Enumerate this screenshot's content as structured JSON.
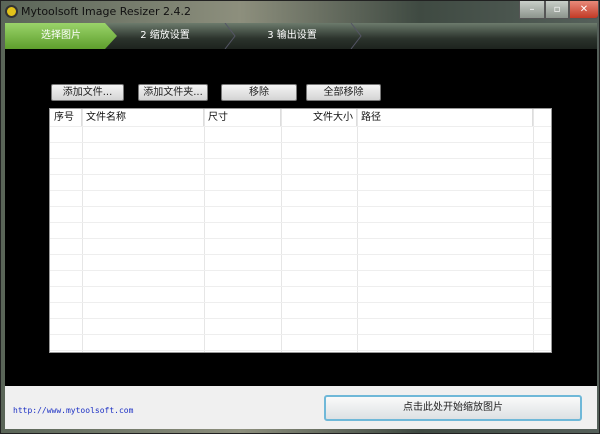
{
  "window": {
    "title": "Mytoolsoft Image Resizer 2.4.2",
    "minimize": "–",
    "maximize": "▫",
    "close": "✕"
  },
  "steps": [
    {
      "label": "选择图片"
    },
    {
      "label": "2  缩放设置"
    },
    {
      "label": "3  输出设置"
    }
  ],
  "toolbar": {
    "add_file": "添加文件...",
    "add_folder": "添加文件夹...",
    "remove": "移除",
    "remove_all": "全部移除"
  },
  "table": {
    "columns": [
      "序号",
      "文件名称",
      "尺寸",
      "文件大小",
      "路径"
    ],
    "rows": []
  },
  "footer": {
    "url": "http://www.mytoolsoft.com",
    "start_button": "点击此处开始缩放图片"
  },
  "colors": {
    "active_step": "#7cbb44",
    "url": "#1b2fc4"
  }
}
